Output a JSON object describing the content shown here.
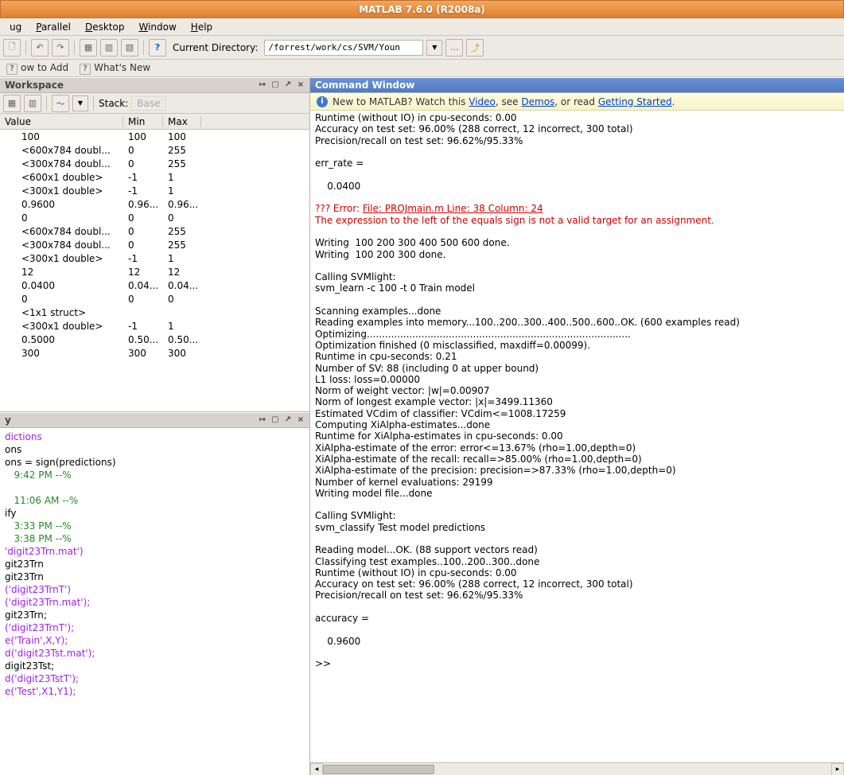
{
  "title": "MATLAB  7.6.0 (R2008a)",
  "menubar": [
    "ug",
    "Parallel",
    "Desktop",
    "Window",
    "Help"
  ],
  "toolbar": {
    "currentDirLabel": "Current Directory:",
    "currentDir": "/forrest/work/cs/SVM/Youn"
  },
  "shortcuts": {
    "howToAdd": "ow to Add",
    "whatsNew": "What's New"
  },
  "workspace": {
    "title": "Workspace",
    "stackLabel": "Stack:",
    "stackValue": "Base",
    "headers": {
      "value": "Value",
      "min": "Min",
      "max": "Max"
    },
    "rows": [
      {
        "value": "100",
        "min": "100",
        "max": "100"
      },
      {
        "value": "<600x784 doubl...",
        "min": "0",
        "max": "255"
      },
      {
        "value": "<300x784 doubl...",
        "min": "0",
        "max": "255"
      },
      {
        "value": "<600x1 double>",
        "min": "-1",
        "max": "1"
      },
      {
        "value": "<300x1 double>",
        "min": "-1",
        "max": "1"
      },
      {
        "value": "0.9600",
        "min": "0.96...",
        "max": "0.96..."
      },
      {
        "value": "0",
        "min": "0",
        "max": "0"
      },
      {
        "value": "<600x784 doubl...",
        "min": "0",
        "max": "255"
      },
      {
        "value": "<300x784 doubl...",
        "min": "0",
        "max": "255"
      },
      {
        "value": "<300x1 double>",
        "min": "-1",
        "max": "1"
      },
      {
        "value": "12",
        "min": "12",
        "max": "12"
      },
      {
        "value": "0.0400",
        "min": "0.04...",
        "max": "0.04..."
      },
      {
        "value": "0",
        "min": "0",
        "max": "0"
      },
      {
        "value": "<1x1 struct>",
        "min": "",
        "max": ""
      },
      {
        "value": "<300x1 double>",
        "min": "-1",
        "max": "1"
      },
      {
        "value": "0.5000",
        "min": "0.50...",
        "max": "0.50..."
      },
      {
        "value": "300",
        "min": "300",
        "max": "300"
      }
    ]
  },
  "history": {
    "title": "y",
    "lines": [
      {
        "t": "dictions",
        "c": "hpurple"
      },
      {
        "t": "ons",
        "c": ""
      },
      {
        "t": "ons = sign(predictions)",
        "c": ""
      },
      {
        "t": "   9:42 PM --%",
        "c": "hgreen"
      },
      {
        "t": "",
        "c": ""
      },
      {
        "t": "   11:06 AM --%",
        "c": "hgreen"
      },
      {
        "t": "ify",
        "c": ""
      },
      {
        "t": "   3:33 PM --%",
        "c": "hgreen"
      },
      {
        "t": "   3:38 PM --%",
        "c": "hgreen"
      },
      {
        "t": "'digit23Trn.mat')",
        "c": "hpurple"
      },
      {
        "t": "git23Trn",
        "c": ""
      },
      {
        "t": "git23Trn",
        "c": ""
      },
      {
        "t": "('digit23TrnT')",
        "c": "hpurple"
      },
      {
        "t": "('digit23Trn.mat');",
        "c": "hpurple"
      },
      {
        "t": "git23Trn;",
        "c": ""
      },
      {
        "t": "('digit23TrnT');",
        "c": "hpurple"
      },
      {
        "t": "e('Train',X,Y);",
        "c": "hpurple"
      },
      {
        "t": "d('digit23Tst.mat');",
        "c": "hpurple"
      },
      {
        "t": "digit23Tst;",
        "c": ""
      },
      {
        "t": "d('digit23TstT');",
        "c": "hpurple"
      },
      {
        "t": "e('Test',X1,Y1);",
        "c": "hpurple"
      }
    ]
  },
  "cmd": {
    "title": "Command Window",
    "info": {
      "pre": "New to MATLAB? Watch this ",
      "video": "Video",
      "mid": ", see ",
      "demos": "Demos",
      "mid2": ", or read ",
      "gs": "Getting Started",
      "post": "."
    },
    "out": [
      "Runtime (without IO) in cpu-seconds: 0.00",
      "Accuracy on test set: 96.00% (288 correct, 12 incorrect, 300 total)",
      "Precision/recall on test set: 96.62%/95.33%",
      "",
      "err_rate =",
      "",
      "    0.0400",
      ""
    ],
    "errPre": "??? Error: ",
    "errLink": "File: PROJmain.m Line: 38 Column: 24",
    "errLine2": "The expression to the left of the equals sign is not a valid target for an assignment.",
    "out2": [
      "",
      "Writing  100 200 300 400 500 600 done.",
      "Writing  100 200 300 done.",
      "",
      "Calling SVMlight:",
      "svm_learn -c 100 -t 0 Train model",
      "",
      "Scanning examples...done",
      "Reading examples into memory...100..200..300..400..500..600..OK. (600 examples read)",
      "Optimizing.......................................................................................",
      "Optimization finished (0 misclassified, maxdiff=0.00099).",
      "Runtime in cpu-seconds: 0.21",
      "Number of SV: 88 (including 0 at upper bound)",
      "L1 loss: loss=0.00000",
      "Norm of weight vector: |w|=0.00907",
      "Norm of longest example vector: |x|=3499.11360",
      "Estimated VCdim of classifier: VCdim<=1008.17259",
      "Computing XiAlpha-estimates...done",
      "Runtime for XiAlpha-estimates in cpu-seconds: 0.00",
      "XiAlpha-estimate of the error: error<=13.67% (rho=1.00,depth=0)",
      "XiAlpha-estimate of the recall: recall=>85.00% (rho=1.00,depth=0)",
      "XiAlpha-estimate of the precision: precision=>87.33% (rho=1.00,depth=0)",
      "Number of kernel evaluations: 29199",
      "Writing model file...done",
      "",
      "Calling SVMlight:",
      "svm_classify Test model predictions",
      "",
      "Reading model...OK. (88 support vectors read)",
      "Classifying test examples..100..200..300..done",
      "Runtime (without IO) in cpu-seconds: 0.00",
      "Accuracy on test set: 96.00% (288 correct, 12 incorrect, 300 total)",
      "Precision/recall on test set: 96.62%/95.33%",
      "",
      "accuracy =",
      "",
      "    0.9600",
      "",
      ">> "
    ]
  }
}
